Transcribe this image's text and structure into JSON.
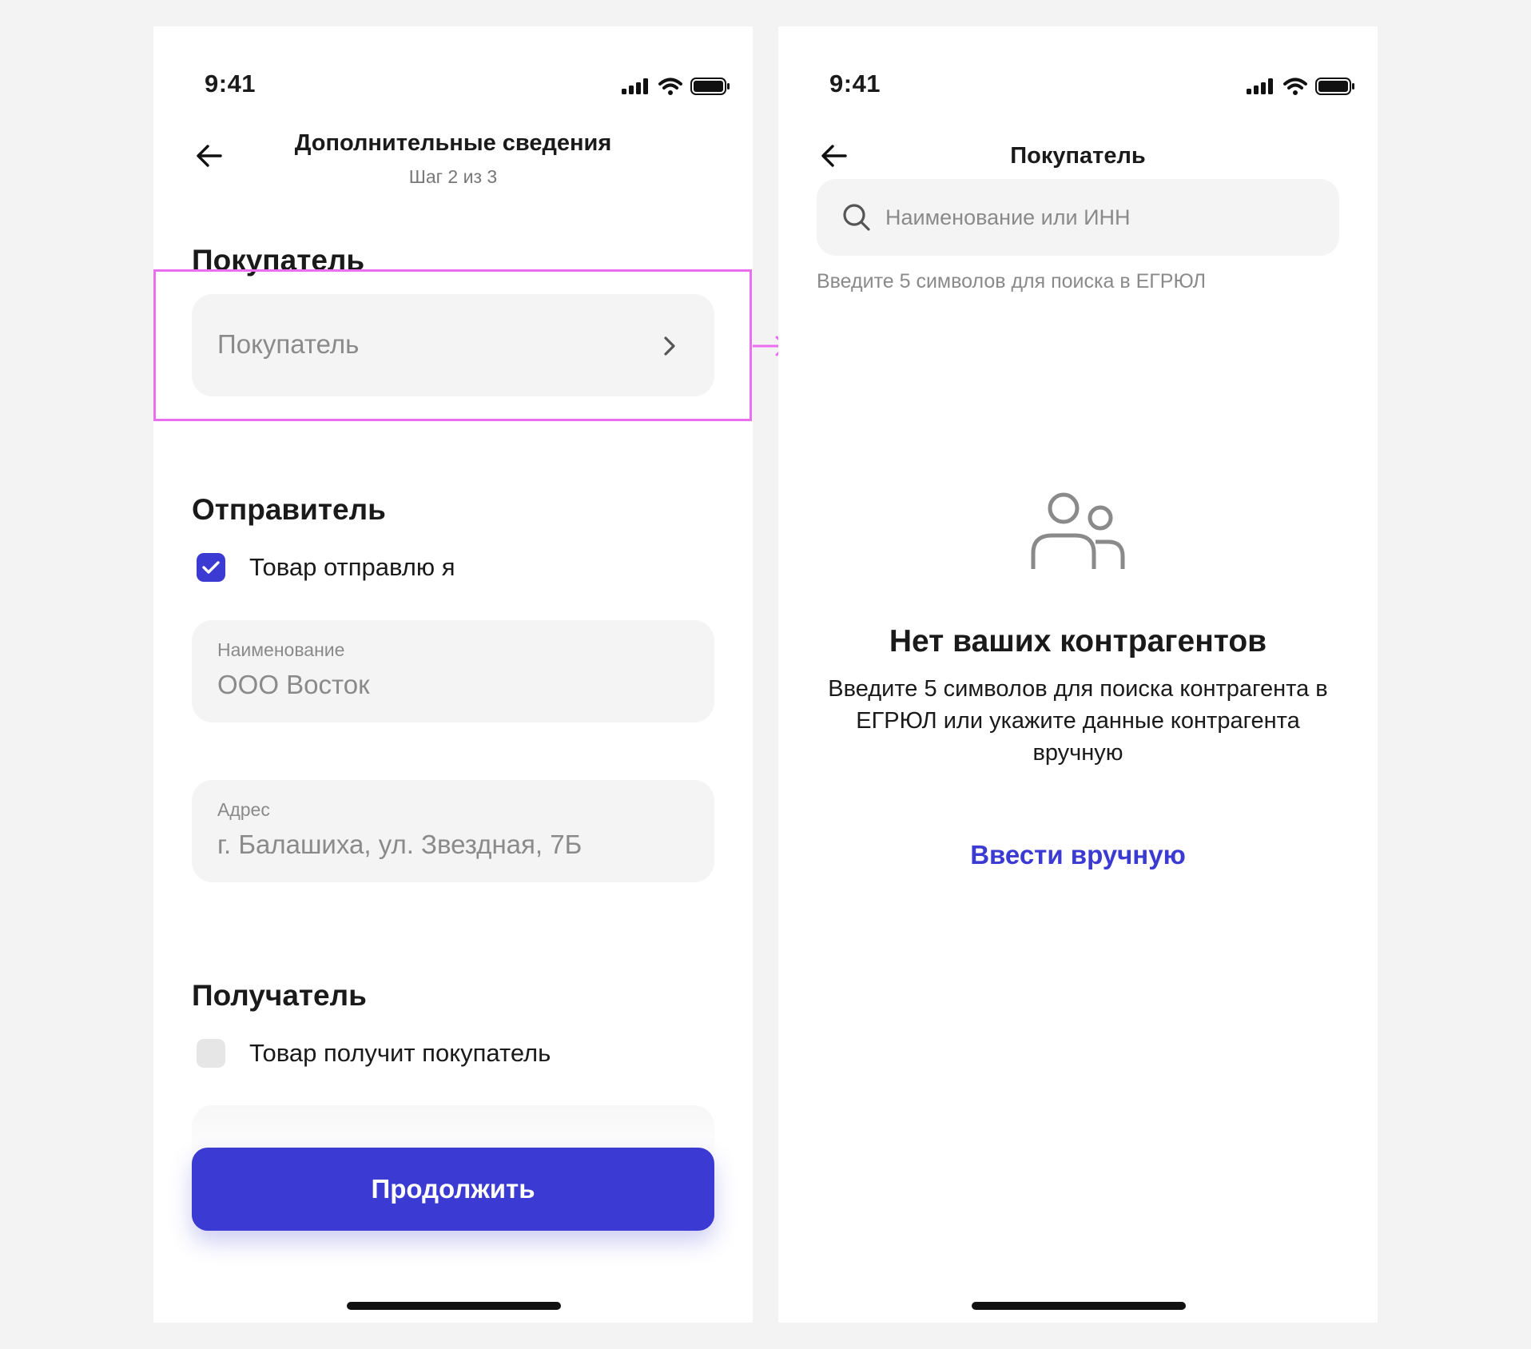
{
  "colors": {
    "accent": "#3b3ad2",
    "highlight": "#ec6ef0",
    "field_bg": "#f4f4f4",
    "muted_text": "#8a8a8a"
  },
  "left_screen": {
    "status_time": "9:41",
    "title": "Дополнительные сведения",
    "subtitle": "Шаг 2 из 3",
    "buyer_section": {
      "title": "Покупатель",
      "field_placeholder": "Покупатель"
    },
    "sender_section": {
      "title": "Отправитель",
      "checkbox_label": "Товар отправлю я",
      "checkbox_checked": true,
      "name_label": "Наименование",
      "name_value": "ООО Восток",
      "address_label": "Адрес",
      "address_value": "г. Балашиха, ул. Звездная, 7Б"
    },
    "recipient_section": {
      "title": "Получатель",
      "checkbox_label": "Товар получит покупатель",
      "checkbox_checked": false
    },
    "continue_label": "Продолжить"
  },
  "right_screen": {
    "status_time": "9:41",
    "title": "Покупатель",
    "search_placeholder": "Наименование или ИНН",
    "search_hint": "Введите 5 символов для поиска в ЕГРЮЛ",
    "empty_title": "Нет ваших контрагентов",
    "empty_text": "Введите 5 символов для поиска контрагента в ЕГРЮЛ или укажите данные контрагента вручную",
    "manual_link": "Ввести вручную"
  },
  "icons": {
    "back": "arrow-left-icon",
    "chevron": "chevron-right-icon",
    "search": "search-icon",
    "empty_state": "users-icon",
    "signal": "signal-icon",
    "wifi": "wifi-icon",
    "battery": "battery-icon",
    "check": "checkmark-icon",
    "flow": "flow-arrow-icon"
  }
}
